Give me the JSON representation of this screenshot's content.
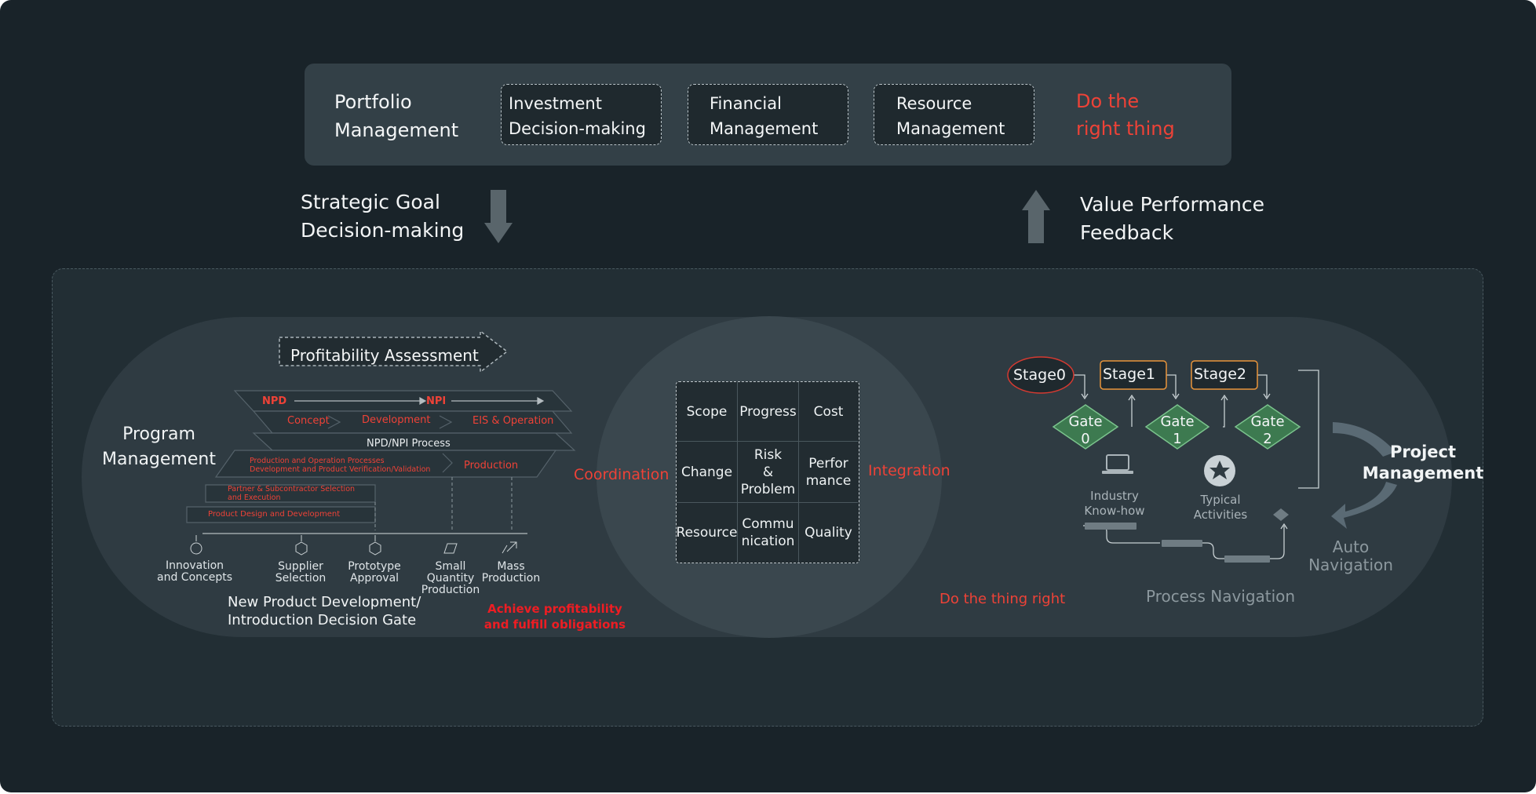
{
  "portfolio": {
    "title": "Portfolio\nManagement",
    "boxes": [
      "Investment\nDecision-making",
      "Financial\nManagement",
      "Resource\nManagement"
    ],
    "motto": "Do the\nright thing"
  },
  "flows": {
    "down_label": "Strategic Goal\nDecision-making",
    "up_label": "Value Performance\nFeedback"
  },
  "program": {
    "title": "Program\nManagement",
    "assessment": "Profitability Assessment",
    "npd": "NPD",
    "npi": "NPI",
    "concept": "Concept",
    "development": "Development",
    "eis": "EIS & Operation",
    "process": "NPD/NPI Process",
    "prod_ops": "Production and Operation Processes\nDevelopment and  Product Verification/Validation",
    "production": "Production",
    "partner": "Partner & Subcontractor Selection\nand Execution",
    "design": "Product Design and Development",
    "milestones": [
      "Innovation\nand Concepts",
      "Supplier\nSelection",
      "Prototype\nApproval",
      "Small\nQuantity\nProduction",
      "Mass\nProduction"
    ],
    "gate_caption": "New Product Development/\nIntroduction Decision Gate",
    "goal": "Achieve profitability\nand fulfill obligations"
  },
  "center": {
    "left_label": "Coordination",
    "right_label": "Integration",
    "cells": [
      "Scope",
      "Progress",
      "Cost",
      "Change",
      "Risk\n&\nProblem",
      "Perfor\nmance",
      "Resource",
      "Commu\nnication",
      "Quality"
    ]
  },
  "project": {
    "stages": [
      "Stage0",
      "Stage1",
      "Stage2"
    ],
    "gates": [
      "Gate\n0",
      "Gate\n1",
      "Gate\n2"
    ],
    "industry": "Industry\nKnow-how",
    "typical": "Typical\nActivities",
    "title": "Project\nManagement",
    "auto": "Auto\nNavigation",
    "process_nav": "Process Navigation",
    "motto": "Do the thing right"
  },
  "colors": {
    "accent_red": "#ee4237",
    "stage_orange": "#e8943a",
    "gate_green": "#4f9a63"
  }
}
